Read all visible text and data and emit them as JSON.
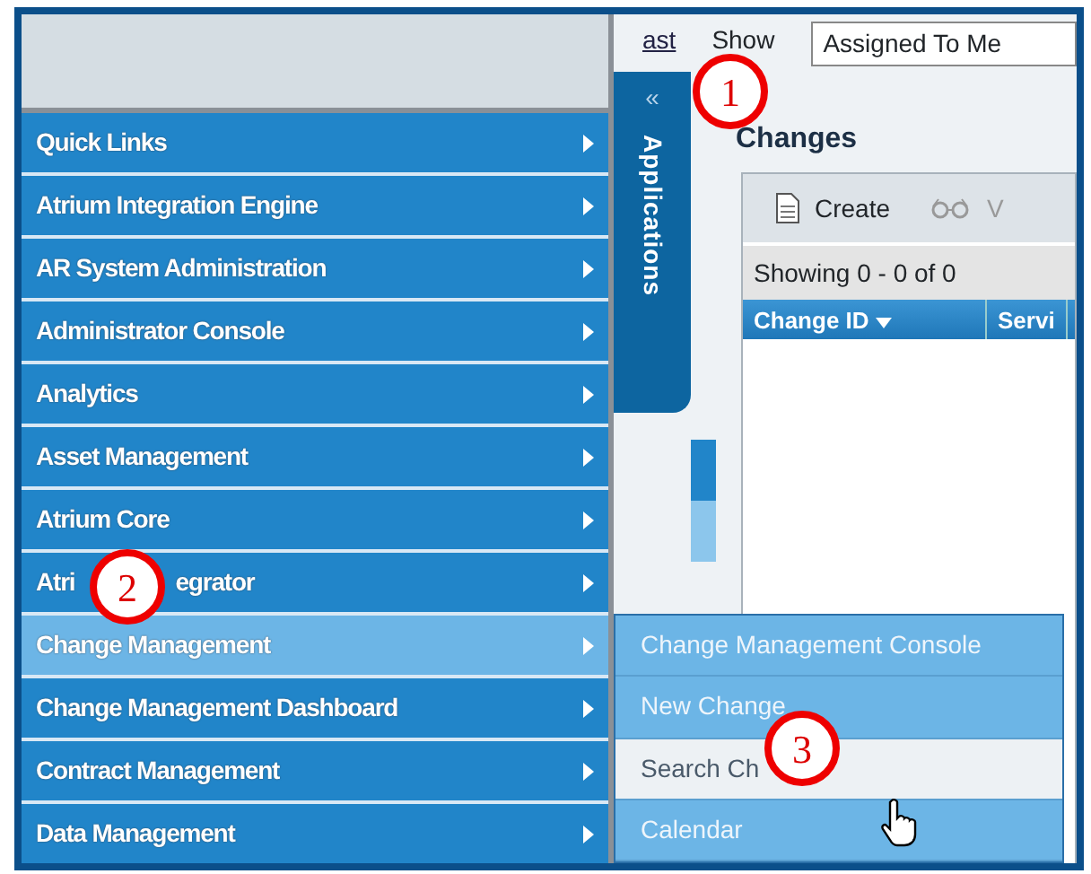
{
  "menu": [
    {
      "label": "Quick Links",
      "selected": false
    },
    {
      "label": "Atrium Integration Engine",
      "selected": false
    },
    {
      "label": "AR System Administration",
      "selected": false
    },
    {
      "label": "Administrator Console",
      "selected": false
    },
    {
      "label": "Analytics",
      "selected": false
    },
    {
      "label": "Asset Management",
      "selected": false
    },
    {
      "label": "Atrium Core",
      "selected": false
    },
    {
      "parts": [
        "Atri",
        "egrator"
      ],
      "selected": false
    },
    {
      "label": "Change Management",
      "selected": true
    },
    {
      "label": "Change Management Dashboard",
      "selected": false
    },
    {
      "label": "Contract Management",
      "selected": false
    },
    {
      "label": "Data Management",
      "selected": false
    }
  ],
  "submenu": [
    {
      "label": "Change Management Console",
      "hovered": false
    },
    {
      "label": "New Change",
      "hovered": false
    },
    {
      "label": "Search Ch",
      "hovered": true
    },
    {
      "label": "Calendar",
      "hovered": false
    }
  ],
  "applications_tab": {
    "collapse": "«",
    "label": "Applications"
  },
  "top_bar": {
    "link": "ast",
    "show_label": "Show",
    "show_value": "Assigned To Me"
  },
  "changes": {
    "title": "Changes",
    "toolbar": [
      {
        "kind": "create",
        "label": "Create"
      },
      {
        "kind": "view",
        "label": "V"
      }
    ],
    "paging": "Showing 0 - 0 of 0",
    "columns": [
      {
        "label": "Change ID",
        "sorted": true
      },
      {
        "label": "Servi",
        "sorted": false
      }
    ]
  },
  "callouts": [
    "1",
    "2",
    "3"
  ]
}
